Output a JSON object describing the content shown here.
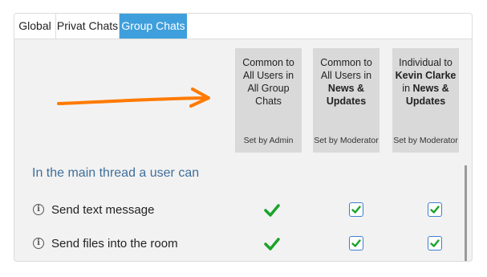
{
  "tabs": [
    {
      "label": "Global",
      "active": false
    },
    {
      "label": "Privat Chats",
      "active": false
    },
    {
      "label": "Group Chats",
      "active": true
    }
  ],
  "columns": [
    {
      "head_parts": [
        "Common to All Users in All Group Chats"
      ],
      "set_by": "Set by Admin"
    },
    {
      "head_line1": "Common to All Users in",
      "head_bold": "News & Updates",
      "set_by": "Set by Moderator"
    },
    {
      "head_line1": "Individual to",
      "head_bold_name": "Kevin Clarke",
      "head_in": "in",
      "head_bold": "News & Updates",
      "set_by": "Set by Moderator"
    }
  ],
  "section": {
    "title": "In the main thread a user can"
  },
  "rows": [
    {
      "label": "Send text message",
      "admin_check": true,
      "moderator_checked": true,
      "individual_checked": true
    },
    {
      "label": "Send files into the room",
      "admin_check": true,
      "moderator_checked": true,
      "individual_checked": true
    }
  ],
  "colors": {
    "accent": "#3f9fdc",
    "check_green": "#1aa32a",
    "arrow": "#ff7a00",
    "section_title": "#3e6f9b"
  },
  "icons": [
    "info-icon",
    "check-icon",
    "checkbox-icon",
    "arrow-icon"
  ]
}
